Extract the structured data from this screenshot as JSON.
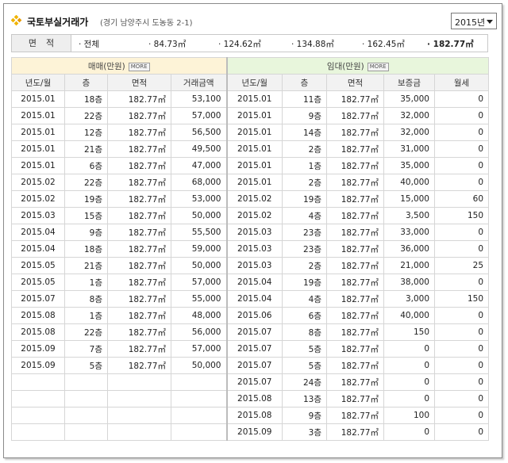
{
  "title": {
    "main": "국토부실거래가",
    "sub": "(경기 남양주시 도농동 2-1)"
  },
  "year_select": {
    "value": "2015년"
  },
  "area": {
    "label": "면적",
    "options": [
      "· 전체",
      "· 84.73㎡",
      "· 124.62㎡",
      "· 134.88㎡",
      "· 162.45㎡",
      "· 182.77㎡"
    ],
    "selected_index": 5
  },
  "sale": {
    "header": "매매(만원)",
    "more_label": "MORE",
    "columns": [
      "년도/월",
      "층",
      "면적",
      "거래금액"
    ],
    "rows": [
      [
        "2015.01",
        "18층",
        "182.77㎡",
        "53,100"
      ],
      [
        "2015.01",
        "22층",
        "182.77㎡",
        "57,000"
      ],
      [
        "2015.01",
        "12층",
        "182.77㎡",
        "56,500"
      ],
      [
        "2015.01",
        "21층",
        "182.77㎡",
        "49,500"
      ],
      [
        "2015.01",
        "6층",
        "182.77㎡",
        "47,000"
      ],
      [
        "2015.02",
        "22층",
        "182.77㎡",
        "68,000"
      ],
      [
        "2015.02",
        "19층",
        "182.77㎡",
        "53,000"
      ],
      [
        "2015.03",
        "15층",
        "182.77㎡",
        "50,000"
      ],
      [
        "2015.04",
        "9층",
        "182.77㎡",
        "55,500"
      ],
      [
        "2015.04",
        "18층",
        "182.77㎡",
        "59,000"
      ],
      [
        "2015.05",
        "21층",
        "182.77㎡",
        "50,000"
      ],
      [
        "2015.05",
        "1층",
        "182.77㎡",
        "57,000"
      ],
      [
        "2015.07",
        "8층",
        "182.77㎡",
        "55,000"
      ],
      [
        "2015.08",
        "1층",
        "182.77㎡",
        "48,000"
      ],
      [
        "2015.08",
        "22층",
        "182.77㎡",
        "56,000"
      ],
      [
        "2015.09",
        "7층",
        "182.77㎡",
        "57,000"
      ],
      [
        "2015.09",
        "5층",
        "182.77㎡",
        "50,000"
      ]
    ]
  },
  "rent": {
    "header": "임대(만원)",
    "more_label": "MORE",
    "columns": [
      "년도/월",
      "층",
      "면적",
      "보증금",
      "월세"
    ],
    "rows": [
      [
        "2015.01",
        "11층",
        "182.77㎡",
        "35,000",
        "0"
      ],
      [
        "2015.01",
        "9층",
        "182.77㎡",
        "32,000",
        "0"
      ],
      [
        "2015.01",
        "14층",
        "182.77㎡",
        "32,000",
        "0"
      ],
      [
        "2015.01",
        "2층",
        "182.77㎡",
        "31,000",
        "0"
      ],
      [
        "2015.01",
        "1층",
        "182.77㎡",
        "35,000",
        "0"
      ],
      [
        "2015.01",
        "2층",
        "182.77㎡",
        "40,000",
        "0"
      ],
      [
        "2015.02",
        "19층",
        "182.77㎡",
        "15,000",
        "60"
      ],
      [
        "2015.02",
        "4층",
        "182.77㎡",
        "3,500",
        "150"
      ],
      [
        "2015.03",
        "23층",
        "182.77㎡",
        "33,000",
        "0"
      ],
      [
        "2015.03",
        "23층",
        "182.77㎡",
        "36,000",
        "0"
      ],
      [
        "2015.03",
        "2층",
        "182.77㎡",
        "21,000",
        "25"
      ],
      [
        "2015.04",
        "19층",
        "182.77㎡",
        "38,000",
        "0"
      ],
      [
        "2015.04",
        "4층",
        "182.77㎡",
        "3,000",
        "150"
      ],
      [
        "2015.06",
        "6층",
        "182.77㎡",
        "40,000",
        "0"
      ],
      [
        "2015.07",
        "8층",
        "182.77㎡",
        "150",
        "0"
      ],
      [
        "2015.07",
        "5층",
        "182.77㎡",
        "0",
        "0"
      ],
      [
        "2015.07",
        "5층",
        "182.77㎡",
        "0",
        "0"
      ],
      [
        "2015.07",
        "24층",
        "182.77㎡",
        "0",
        "0"
      ],
      [
        "2015.08",
        "13층",
        "182.77㎡",
        "0",
        "0"
      ],
      [
        "2015.08",
        "9층",
        "182.77㎡",
        "100",
        "0"
      ],
      [
        "2015.09",
        "3층",
        "182.77㎡",
        "0",
        "0"
      ]
    ]
  },
  "colors": {
    "sale_header": "#fdf3d7",
    "rent_header": "#e8f6dc",
    "icon": "#e8a400"
  },
  "icons": {
    "title": "diamond-bullet-icon"
  }
}
